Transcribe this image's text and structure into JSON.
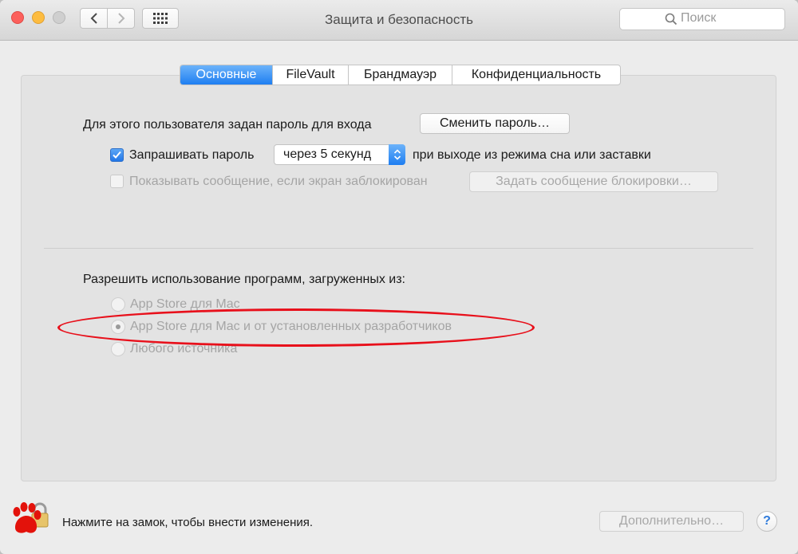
{
  "window": {
    "title": "Защита и безопасность"
  },
  "toolbar": {
    "back_icon": "chevron-left-icon",
    "forward_icon": "chevron-right-icon",
    "show_all_icon": "grid-icon",
    "search_placeholder": "Поиск"
  },
  "tabs": [
    {
      "label": "Основные",
      "active": true
    },
    {
      "label": "FileVault",
      "active": false
    },
    {
      "label": "Брандмауэр",
      "active": false
    },
    {
      "label": "Конфиденциальность",
      "active": false
    }
  ],
  "general": {
    "password_set_text": "Для этого пользователя задан пароль для входа",
    "change_password_button": "Сменить пароль…",
    "require_password": {
      "checked": true,
      "label": "Запрашивать пароль",
      "delay_value": "через 5 секунд",
      "suffix": "при выходе из режима сна или заставки"
    },
    "show_message": {
      "checked": false,
      "label": "Показывать сообщение, если экран заблокирован",
      "button": "Задать сообщение блокировки…"
    }
  },
  "downloads": {
    "heading": "Разрешить использование программ, загруженных из:",
    "options": [
      {
        "label": "App Store для Mac",
        "selected": false
      },
      {
        "label": "App Store для Mac и от установленных разработчиков",
        "selected": true
      },
      {
        "label": "Любого источника",
        "selected": false
      }
    ]
  },
  "footer": {
    "lock_text": "Нажмите на замок, чтобы внести изменения.",
    "advanced_button": "Дополнительно…",
    "help_label": "?"
  },
  "colors": {
    "accent": "#1e7ef1",
    "highlight_ring": "#e8101b",
    "lock_icon": "#e3120b"
  }
}
